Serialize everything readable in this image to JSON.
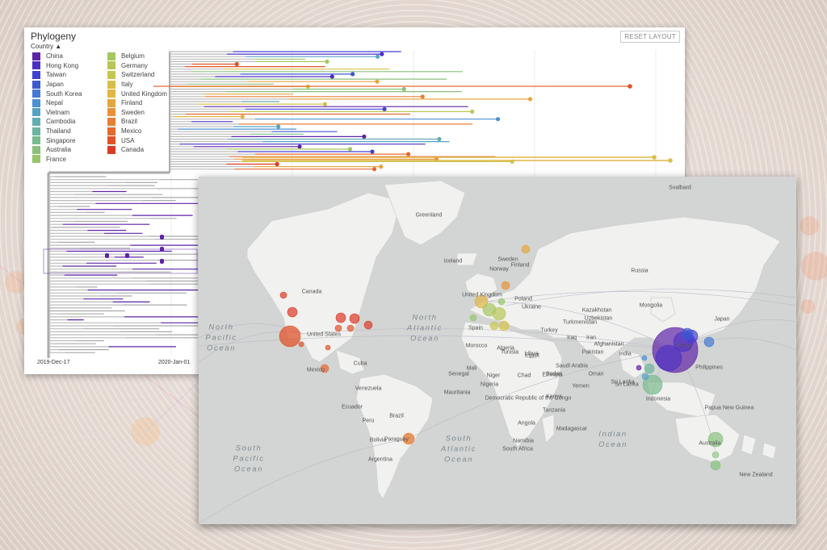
{
  "phylogeny": {
    "title": "Phylogeny",
    "reset_label": "RESET LAYOUT",
    "color_by_label": "Country",
    "legend_col1": [
      {
        "label": "China",
        "color": "#5e23a6"
      },
      {
        "label": "Hong Kong",
        "color": "#4a2fc4"
      },
      {
        "label": "Taiwan",
        "color": "#4140d4"
      },
      {
        "label": "Japan",
        "color": "#3e58cf"
      },
      {
        "label": "South Korea",
        "color": "#4479d6"
      },
      {
        "label": "Nepal",
        "color": "#4b8fd4"
      },
      {
        "label": "Vietnam",
        "color": "#56a2c7"
      },
      {
        "label": "Cambodia",
        "color": "#62acb4"
      },
      {
        "label": "Thailand",
        "color": "#6cb4a0"
      },
      {
        "label": "Singapore",
        "color": "#79bb8d"
      },
      {
        "label": "Australia",
        "color": "#88c07c"
      },
      {
        "label": "France",
        "color": "#98c46c"
      }
    ],
    "legend_col2": [
      {
        "label": "Belgium",
        "color": "#a7c661"
      },
      {
        "label": "Germany",
        "color": "#b8c758"
      },
      {
        "label": "Switzerland",
        "color": "#c8c650"
      },
      {
        "label": "Italy",
        "color": "#d6c04a"
      },
      {
        "label": "United Kingdom",
        "color": "#e1b545"
      },
      {
        "label": "Finland",
        "color": "#e6a53f"
      },
      {
        "label": "Sweden",
        "color": "#e8933a"
      },
      {
        "label": "Brazil",
        "color": "#e67f35"
      },
      {
        "label": "Mexico",
        "color": "#e36a30"
      },
      {
        "label": "USA",
        "color": "#df532b"
      },
      {
        "label": "Canada",
        "color": "#db3b26"
      }
    ],
    "x_ticks": [
      "2019-Dec-17",
      "2020-Jan-01"
    ]
  },
  "map": {
    "oceans": [
      {
        "text": "North\nPacific\nOcean"
      },
      {
        "text": "North\nAtlantic\nOcean"
      },
      {
        "text": "South\nPacific\nOcean"
      },
      {
        "text": "South\nAtlantic\nOcean"
      },
      {
        "text": "Indian\nOcean"
      }
    ],
    "labels": [
      "Greenland",
      "Svalbard",
      "Iceland",
      "Canada",
      "United States",
      "Mexico",
      "Cuba",
      "Venezuela",
      "Ecuador",
      "Peru",
      "Brazil",
      "Bolivia",
      "Paraguay",
      "Argentina",
      "Morocco",
      "Algeria",
      "Libya",
      "Egypt",
      "Sudan",
      "Niger",
      "Chad",
      "Mali",
      "Senegal",
      "Nigeria",
      "Ethiopia",
      "Kenya",
      "Tanzania",
      "Angola",
      "Namibia",
      "South Africa",
      "Madagascar",
      "Democratic Republic of the Congo",
      "Sweden",
      "Norway",
      "Finland",
      "Russia",
      "Kazakhstan",
      "Ukraine",
      "Turkey",
      "Iran",
      "Iraq",
      "Saudi Arabia",
      "Oman",
      "Yemen",
      "Afghanistan",
      "Pakistan",
      "India",
      "Sri Lanka",
      "Mongolia",
      "China",
      "Japan",
      "Philippines",
      "Indonesia",
      "Papua New Guinea",
      "Australia",
      "New Zealand",
      "Spain",
      "Poland",
      "United Kingdom",
      "Turkmenistan",
      "Uzbekistan",
      "Tunisia",
      "Mauritania",
      "Sri Lanka"
    ],
    "countries": [
      {
        "name": "China",
        "color": "#5e23a6"
      },
      {
        "name": "USA",
        "color": "#df532b"
      },
      {
        "name": "Australia",
        "color": "#88c07c"
      },
      {
        "name": "Singapore",
        "color": "#79bb8d"
      },
      {
        "name": "Brazil",
        "color": "#e67f35"
      },
      {
        "name": "Japan",
        "color": "#3e58cf"
      }
    ]
  }
}
